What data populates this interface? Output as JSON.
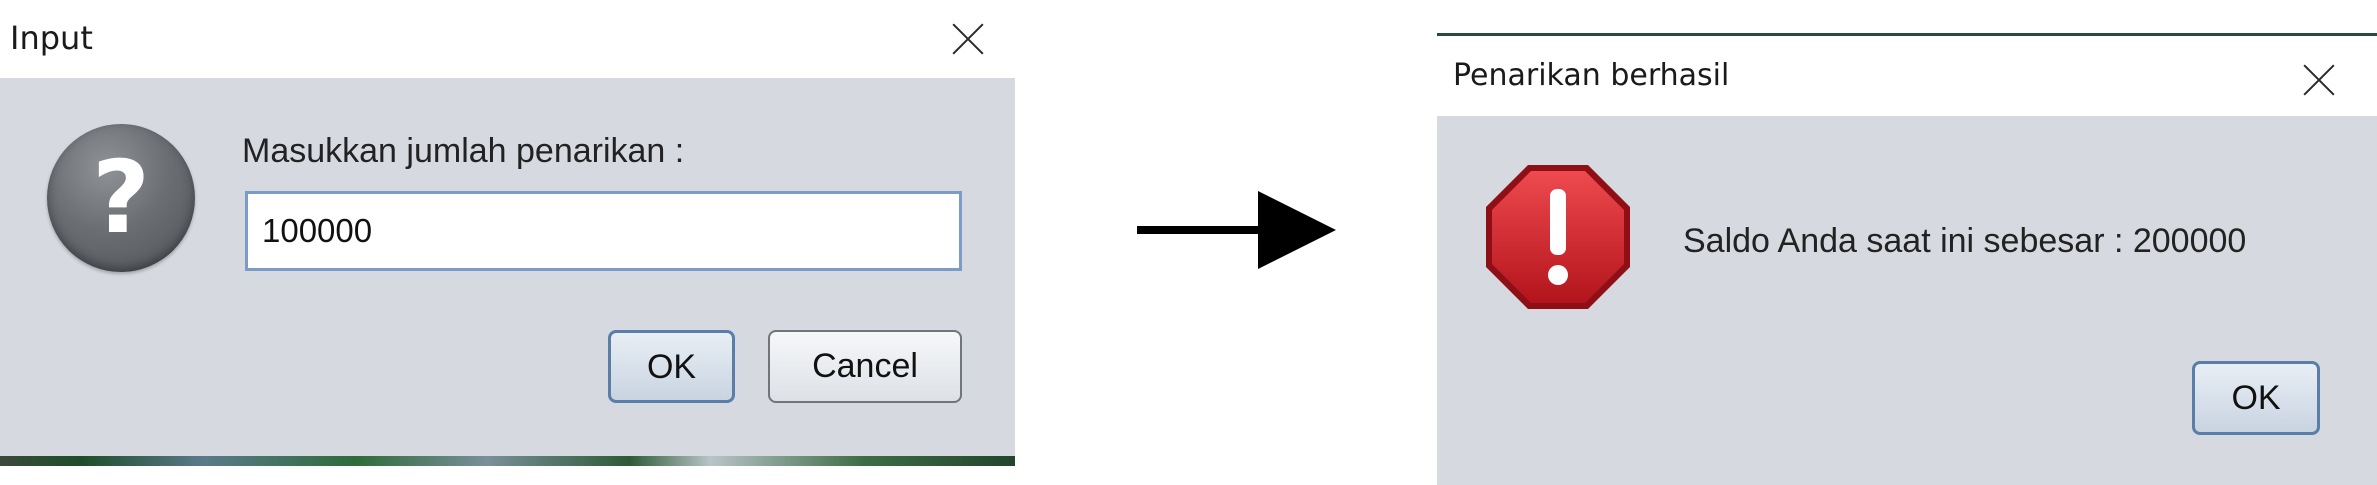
{
  "input_dialog": {
    "title": "Input",
    "prompt": "Masukkan jumlah penarikan :",
    "input_value": "100000",
    "ok_label": "OK",
    "cancel_label": "Cancel",
    "icon": "question-icon"
  },
  "arrow": {
    "icon": "right-arrow-icon"
  },
  "result_dialog": {
    "title": "Penarikan berhasil",
    "message": "Saldo Anda saat ini sebesar : 200000",
    "ok_label": "OK",
    "icon": "warning-stop-icon"
  },
  "colors": {
    "dialog_bg": "#d6d9df",
    "titlebar_bg": "#ffffff",
    "input_border": "#7a9cc6",
    "warning_red": "#d4222a",
    "question_gray": "#6b6f74"
  }
}
